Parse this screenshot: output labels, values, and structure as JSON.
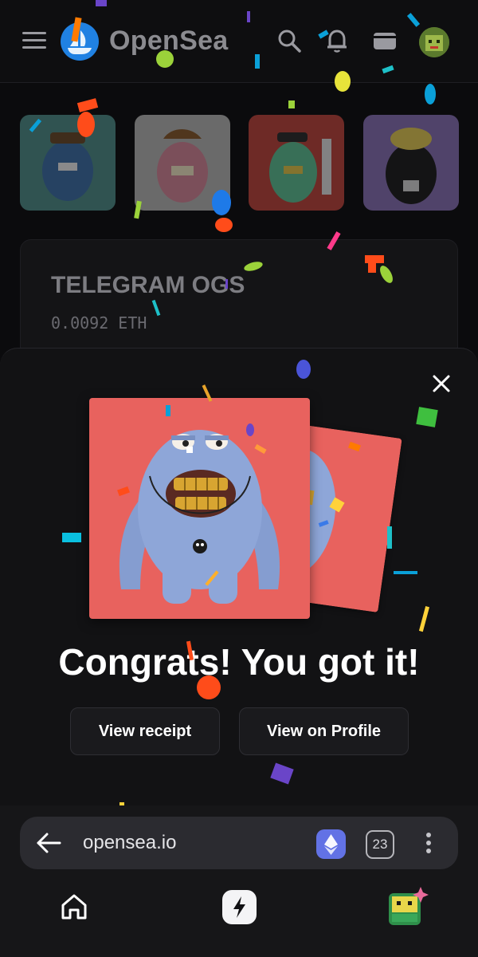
{
  "header": {
    "brand_name": "OpenSea",
    "icons": [
      "menu-icon",
      "opensea-logo",
      "search-icon",
      "bell-icon",
      "wallet-icon",
      "avatar"
    ]
  },
  "collection": {
    "title": "TELEGRAM OGS",
    "price": "0.0092 ETH"
  },
  "modal": {
    "heading": "Congrats! You got it!",
    "view_receipt_label": "View receipt",
    "view_profile_label": "View on Profile"
  },
  "browser": {
    "url": "opensea.io",
    "tab_count": "23"
  },
  "colors": {
    "background": "#0b0b0d",
    "sheet": "#121214",
    "nft_bg": "#e8625e",
    "monster_blue": "#8ea6d8",
    "eth_badge": "#6272e5",
    "opensea_blue": "#2081e2"
  }
}
